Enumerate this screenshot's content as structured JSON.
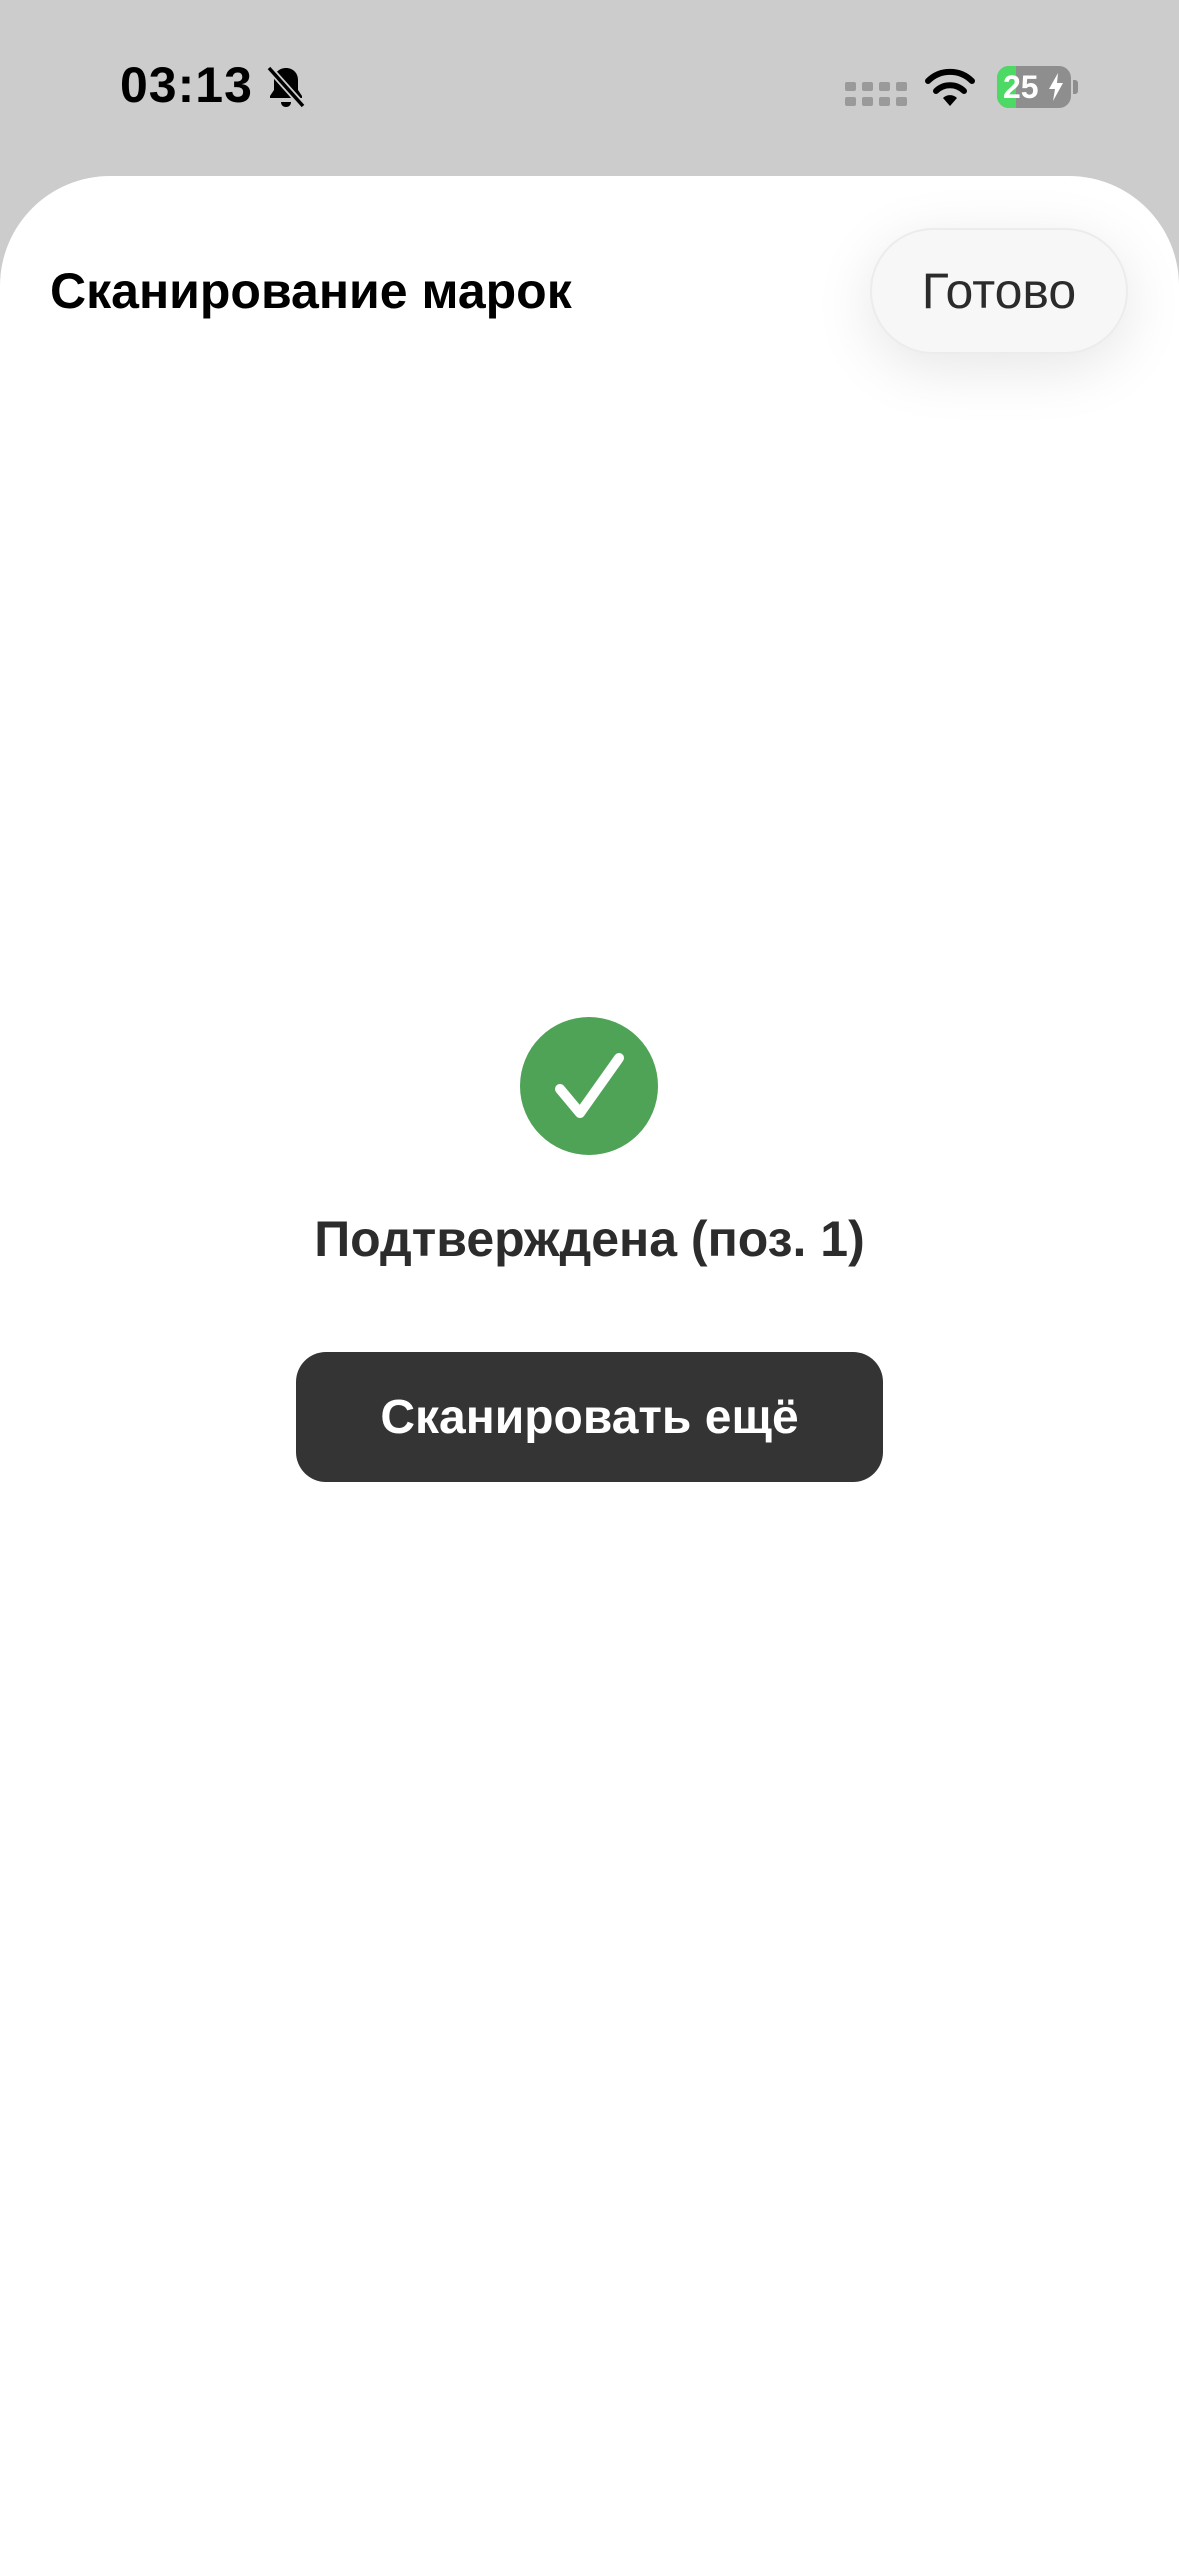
{
  "status_bar": {
    "time": "03:13",
    "battery_level": "25",
    "battery_fraction": 0.25,
    "icons": [
      "bell-slash-icon",
      "cellular-icon",
      "wifi-icon",
      "battery-icon",
      "bolt-icon"
    ]
  },
  "sheet": {
    "title": "Сканирование марок",
    "done_label": "Готово"
  },
  "result": {
    "icon": "checkmark-circle-icon",
    "status_text": "Подтверждена (поз. 1)",
    "scan_more_label": "Сканировать ещё"
  },
  "colors": {
    "background_dim": "#cccccc",
    "sheet_background": "#ffffff",
    "success_green": "#4ea356",
    "primary_button": "#343434",
    "battery_green": "#4cd964"
  }
}
